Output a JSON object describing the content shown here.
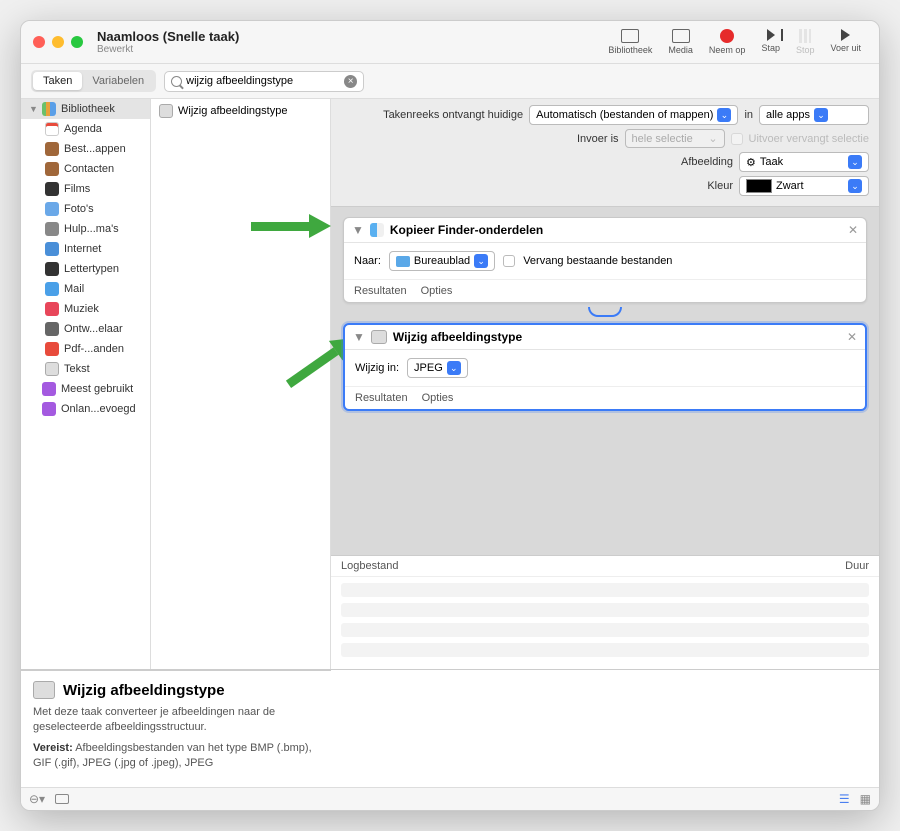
{
  "title": "Naamloos (Snelle taak)",
  "subtitle": "Bewerkt",
  "toolbar": {
    "library": "Bibliotheek",
    "media": "Media",
    "record": "Neem op",
    "step": "Stap",
    "stop": "Stop",
    "run": "Voer uit"
  },
  "tabs": {
    "actions": "Taken",
    "variables": "Variabelen"
  },
  "search": {
    "value": "wijzig afbeeldingstype"
  },
  "sidebar": {
    "library": "Bibliotheek",
    "items": [
      "Agenda",
      "Best...appen",
      "Contacten",
      "Films",
      "Foto's",
      "Hulp...ma's",
      "Internet",
      "Lettertypen",
      "Mail",
      "Muziek",
      "Ontw...elaar",
      "Pdf-...anden",
      "Tekst"
    ],
    "most_used": "Meest gebruikt",
    "recent": "Onlan...evoegd"
  },
  "midcol": {
    "item": "Wijzig afbeeldingstype"
  },
  "wf_options": {
    "receives": "Takenreeks ontvangt huidige",
    "receives_val": "Automatisch (bestanden of mappen)",
    "in": "in",
    "in_val": "alle apps",
    "input": "Invoer is",
    "input_val": "hele selectie",
    "output_replaces": "Uitvoer vervangt selectie",
    "image": "Afbeelding",
    "image_val": "Taak",
    "color": "Kleur",
    "color_val": "Zwart"
  },
  "action1": {
    "title": "Kopieer Finder-onderdelen",
    "to": "Naar:",
    "to_val": "Bureaublad",
    "replace": "Vervang bestaande bestanden",
    "results": "Resultaten",
    "options": "Opties"
  },
  "action2": {
    "title": "Wijzig afbeeldingstype",
    "change": "Wijzig in:",
    "change_val": "JPEG",
    "results": "Resultaten",
    "options": "Opties"
  },
  "log": {
    "file": "Logbestand",
    "duration": "Duur"
  },
  "desc": {
    "title": "Wijzig afbeeldingstype",
    "text": "Met deze taak converteer je afbeeldingen naar de geselecteerde afbeeldingsstructuur.",
    "req_label": "Vereist:",
    "req": "Afbeeldingsbestanden van het type BMP (.bmp), GIF (.gif), JPEG (.jpg of .jpeg), JPEG"
  }
}
